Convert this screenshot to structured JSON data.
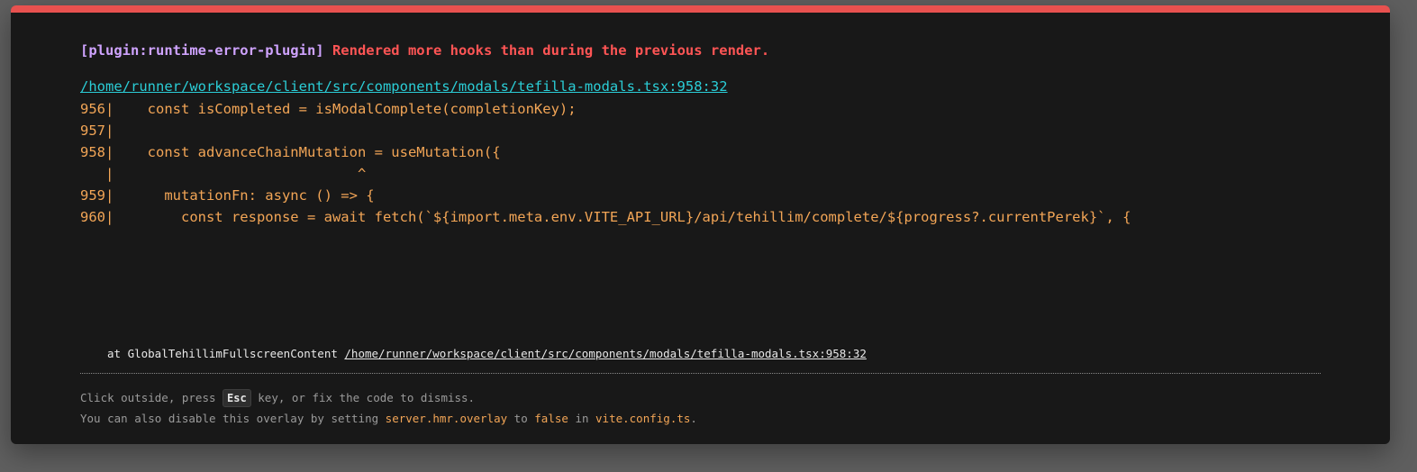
{
  "error": {
    "plugin": "[plugin:runtime-error-plugin]",
    "message": "Rendered more hooks than during the previous render.",
    "file": "/home/runner/workspace/client/src/components/modals/tefilla-modals.tsx:958:32"
  },
  "frame": [
    "956|    const isCompleted = isModalComplete(completionKey);",
    "957|",
    "958|    const advanceChainMutation = useMutation({",
    "   |                             ^",
    "959|      mutationFn: async () => {",
    "960|        const response = await fetch(`${import.meta.env.VITE_API_URL}/api/tehillim/complete/${progress?.currentPerek}`, {"
  ],
  "stack": {
    "prefix": "at GlobalTehillimFullscreenContent",
    "link": "/home/runner/workspace/client/src/components/modals/tefilla-modals.tsx:958:32"
  },
  "tip": {
    "line1_before": "Click outside, press",
    "key": "Esc",
    "line1_after": "key, or fix the code to dismiss.",
    "line2_a": "You can also disable this overlay by setting",
    "config_option": "server.hmr.overlay",
    "line2_b": "to",
    "value": "false",
    "line2_c": "in",
    "config_file": "vite.config.ts",
    "line2_end": "."
  },
  "colors": {
    "accent_bar": "#e8514f",
    "plugin": "#cfa3ff",
    "message": "#ff5555",
    "file_link": "#2bcdd6",
    "code": "#f2a556",
    "background": "#181818"
  }
}
